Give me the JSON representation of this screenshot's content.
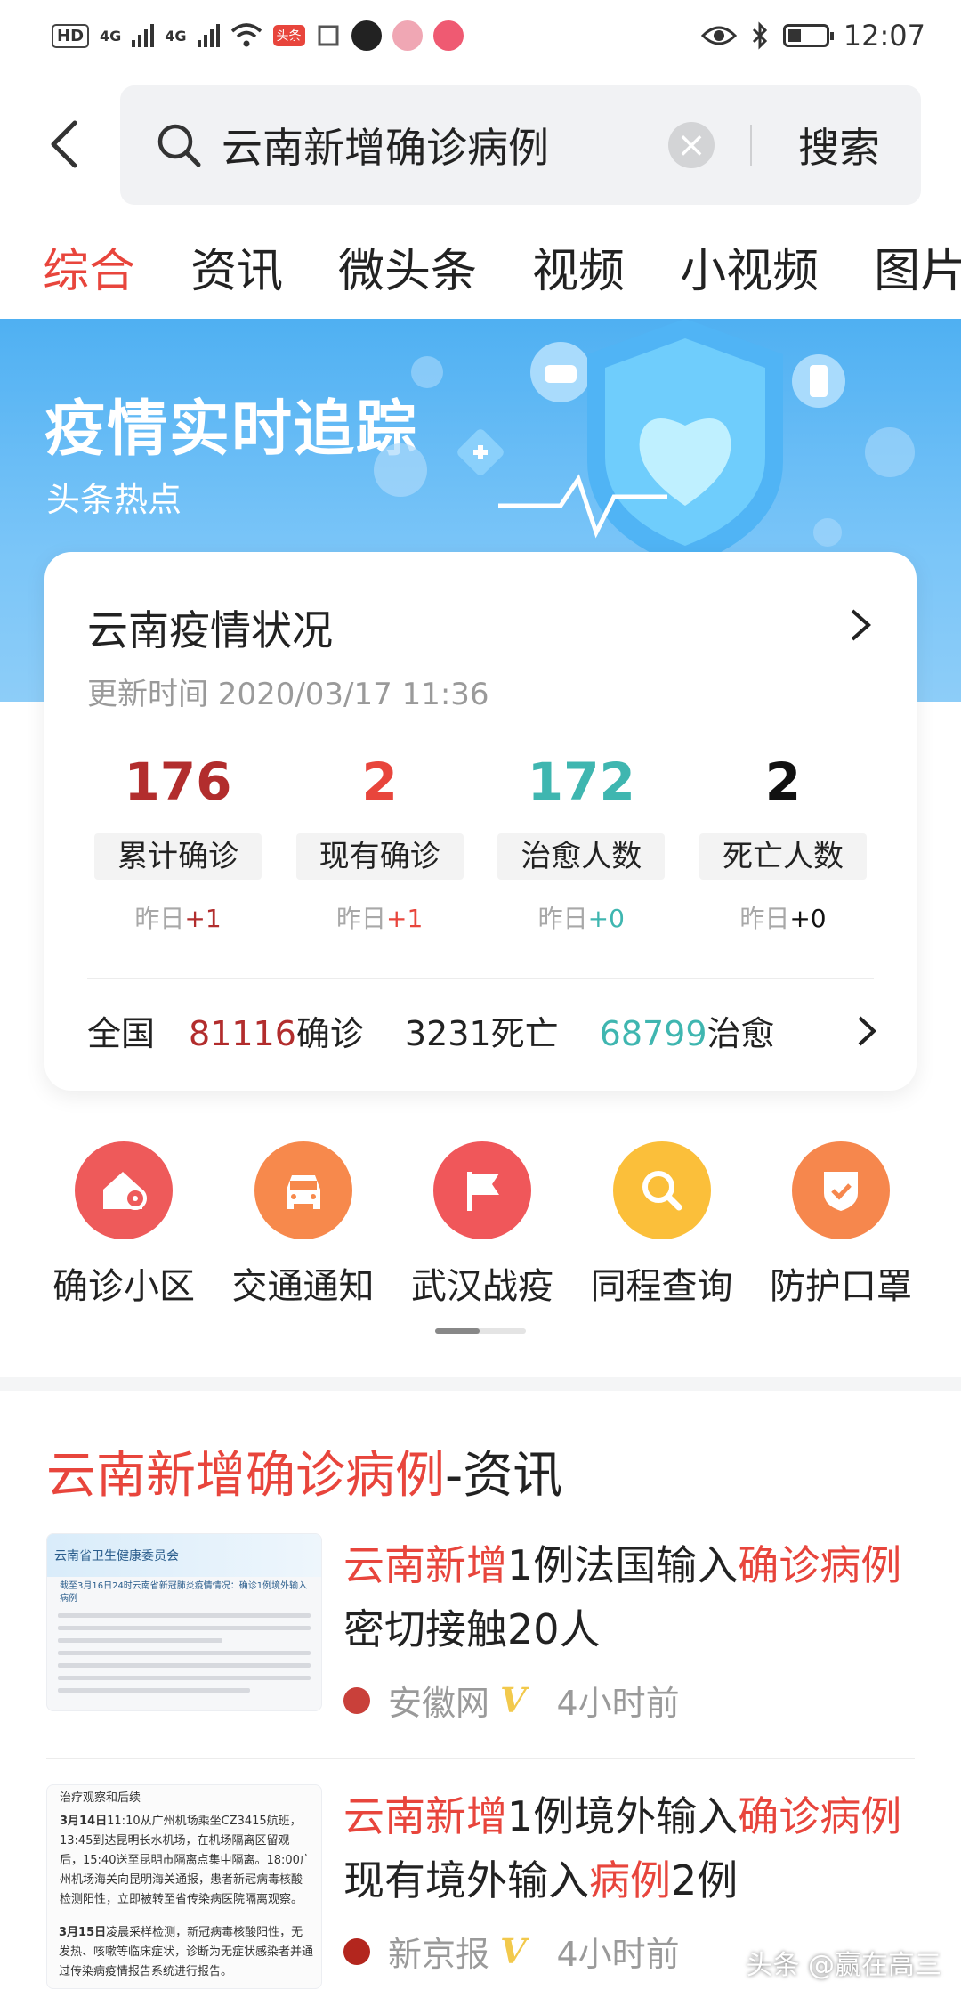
{
  "status_bar": {
    "hd": "HD",
    "sig1": "4G",
    "sig2": "4G",
    "toutiao_chip": "头条",
    "time": "12:07"
  },
  "search": {
    "query": "云南新增确诊病例",
    "clear_icon": "clear-icon",
    "submit_label": "搜索"
  },
  "tabs": [
    "综合",
    "资讯",
    "微头条",
    "视频",
    "小视频",
    "图片"
  ],
  "banner": {
    "title": "疫情实时追踪",
    "subtitle": "头条热点",
    "bg_color": "#4fb0f2"
  },
  "card": {
    "title": "云南疫情状况",
    "update_time": "更新时间 2020/03/17 11:36",
    "stats": [
      {
        "value": "176",
        "label": "累计确诊",
        "delta_prefix": "昨日",
        "delta": "+1",
        "color": "#b22d2d"
      },
      {
        "value": "2",
        "label": "现有确诊",
        "delta_prefix": "昨日",
        "delta": "+1",
        "color": "#e8453c"
      },
      {
        "value": "172",
        "label": "治愈人数",
        "delta_prefix": "昨日",
        "delta": "+0",
        "color": "#3fb6b0"
      },
      {
        "value": "2",
        "label": "死亡人数",
        "delta_prefix": "昨日",
        "delta": "+0",
        "color": "#111111"
      }
    ],
    "nation": {
      "label": "全国",
      "confirmed_value": "81116",
      "confirmed_label": "确诊",
      "deaths_value": "3231",
      "deaths_label": "死亡",
      "cured_value": "68799",
      "cured_label": "治愈"
    }
  },
  "shortcuts": [
    {
      "label": "确诊小区",
      "icon": "home-location-icon",
      "color": "#ee5a5a"
    },
    {
      "label": "交通通知",
      "icon": "car-icon",
      "color": "#f7894c"
    },
    {
      "label": "武汉战疫",
      "icon": "flag-icon",
      "color": "#f0575a"
    },
    {
      "label": "同程查询",
      "icon": "search-icon",
      "color": "#fbbf3a"
    },
    {
      "label": "防护口罩",
      "icon": "shield-check-icon",
      "color": "#f6874d"
    }
  ],
  "news_section": {
    "title_highlight": "云南新增确诊病例",
    "title_suffix": "-资讯"
  },
  "news": [
    {
      "headline_parts": [
        {
          "text": "云南新增",
          "hl": true
        },
        {
          "text": "1例法国输入",
          "hl": false
        },
        {
          "text": "确诊病例",
          "hl": true
        },
        {
          "text": " 密切接触20人",
          "hl": false
        }
      ],
      "source": "安徽网",
      "verified": "V",
      "time": "4小时前",
      "thumb": {
        "header": "云南省卫生健康委员会",
        "subheader": "截至3月16日24时云南省新冠肺炎疫情情况：确诊1例境外输入病例"
      }
    },
    {
      "headline_parts": [
        {
          "text": "云南新增",
          "hl": true
        },
        {
          "text": "1例境外输入",
          "hl": false
        },
        {
          "text": "确诊病例",
          "hl": true
        },
        {
          "text": " 现有境外输入",
          "hl": false
        },
        {
          "text": "病例",
          "hl": true
        },
        {
          "text": "2例",
          "hl": false
        }
      ],
      "source": "新京报",
      "verified": "V",
      "time": "4小时前",
      "thumb": {
        "top_text": "治疗观察和后续",
        "para1_date": "3月14日",
        "para1": "11:10从广州机场乘坐CZ3415航班，13:45到达昆明长水机场，在机场隔离区留观后，15:40送至昆明市隔离点集中隔离。18:00广州机场海关向昆明海关通报，患者新冠病毒核酸检测阳性，立即被转至省传染病医院隔离观察。",
        "para2_date": "3月15日",
        "para2": "凌晨采样检测，新冠病毒核酸阳性，无发热、咳嗽等临床症状，诊断为无症状感染者并通过传染病疫情报告系统进行报告。"
      }
    }
  ],
  "watermark": "头条 @赢在高三"
}
